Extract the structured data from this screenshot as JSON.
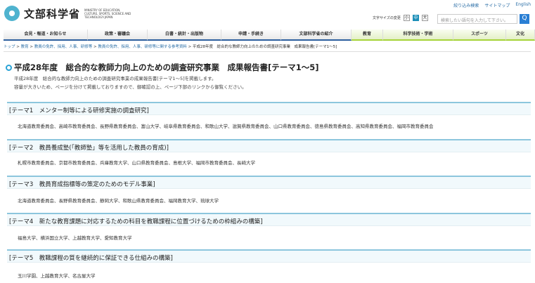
{
  "header": {
    "logo_name": "文部科学省",
    "logo_en": "MINISTRY OF EDUCATION, CULTURE, SPORTS, SCIENCE AND TECHNOLOGY-JAPAN",
    "links": [
      "絞り込み検索",
      "サイトマップ",
      "English"
    ],
    "font_size_label": "文字サイズの変更",
    "font_sizes": [
      "小",
      "中",
      "大"
    ],
    "search_placeholder": "検索したい語句を入力して下さい。",
    "search_button": "Q"
  },
  "nav": [
    "会見・報道・お知らせ",
    "政策・審議会",
    "白書・統計・出版物",
    "申請・手続き",
    "文部科学省の紹介",
    "教育",
    "科学技術・学術",
    "スポーツ",
    "文化"
  ],
  "breadcrumb": {
    "links": [
      "トップ",
      "教育",
      "教員の免許、採用、人事、研修等",
      "教員の免許、採用、人事、研修等に関する参考資料"
    ],
    "current": "平成28年度　総合的な教師力向上のための調査研究事業　成果報告書[テーマ1～5]",
    "sep": " > "
  },
  "page": {
    "title": "平成28年度　総合的な教師力向上のための調査研究事業　成果報告書[テーマ1～5]",
    "intro": [
      "平成28年度　総合的な教師力向上のための調査研究事業の成果報告書[テーマ1～5]を掲載します。",
      "容量が大きいため、ページを分けて掲載しておりますので、御確認の上、ページ下部のリンクから御覧ください。"
    ]
  },
  "sections": [
    {
      "title": "[テーマ1　メンター制等による研修実施の調査研究]",
      "body": "北海道教育委員会、高崎市教育委員会、長野県教育委員会、富山大学、岐阜県教育委員会、和歌山大学、滋賀県教育委員会、山口県教育委員会、徳島県教育委員会、高知県教育委員会、福岡市教育委員会"
    },
    {
      "title": "[テーマ2　教員養成塾(「教師塾」等を活用した教員の育成)]",
      "body": "札幌市教育委員会、京都市教育委員会、兵庫教育大学、山口県教育委員会、島根大学、福岡市教育委員会、長崎大学"
    },
    {
      "title": "[テーマ3　教員育成指標等の策定のためのモデル事業]",
      "body": "北海道教育委員会、長野県教育委員会、静岡大学、和歌山県教育委員会、福岡教育大学、琉球大学"
    },
    {
      "title": "[テーマ4　新たな教育課題に対応するための科目を教職課程に位置づけるための枠組みの構築]",
      "body": "福島大学、横浜国立大学、上越教育大学、愛知教育大学"
    },
    {
      "title": "[テーマ5　教職課程の質を継続的に保証できる仕組みの構築]",
      "body": "玉川学園、上越教育大学、名古屋大学"
    }
  ]
}
